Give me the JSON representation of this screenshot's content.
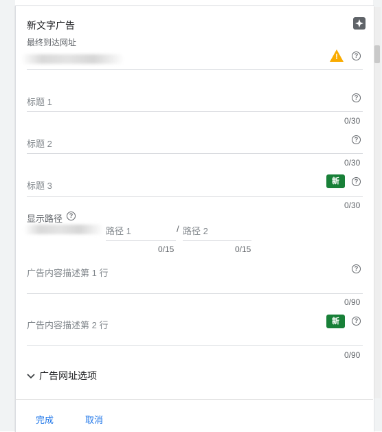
{
  "card": {
    "title": "新文字广告",
    "final_url_label": "最终到达网址"
  },
  "fields": {
    "headline1": {
      "label": "标题 1",
      "counter": "0/30"
    },
    "headline2": {
      "label": "标题 2",
      "counter": "0/30"
    },
    "headline3": {
      "label": "标题 3",
      "counter": "0/30",
      "badge": "新"
    },
    "display_path": {
      "label": "显示路径",
      "path1": "路径 1",
      "separator": "/",
      "path2": "路径 2",
      "counter1": "0/15",
      "counter2": "0/15"
    },
    "desc1": {
      "label": "广告内容描述第 1 行",
      "counter": "0/90"
    },
    "desc2": {
      "label": "广告内容描述第 2 行",
      "counter": "0/90",
      "badge": "新"
    }
  },
  "help_glyph": "?",
  "warning_glyph": "!",
  "url_options": {
    "label": "广告网址选项"
  },
  "footer": {
    "done": "完成",
    "cancel": "取消"
  },
  "colors": {
    "accent": "#1a73e8",
    "badge": "#188038",
    "warning": "#f9ab00"
  }
}
